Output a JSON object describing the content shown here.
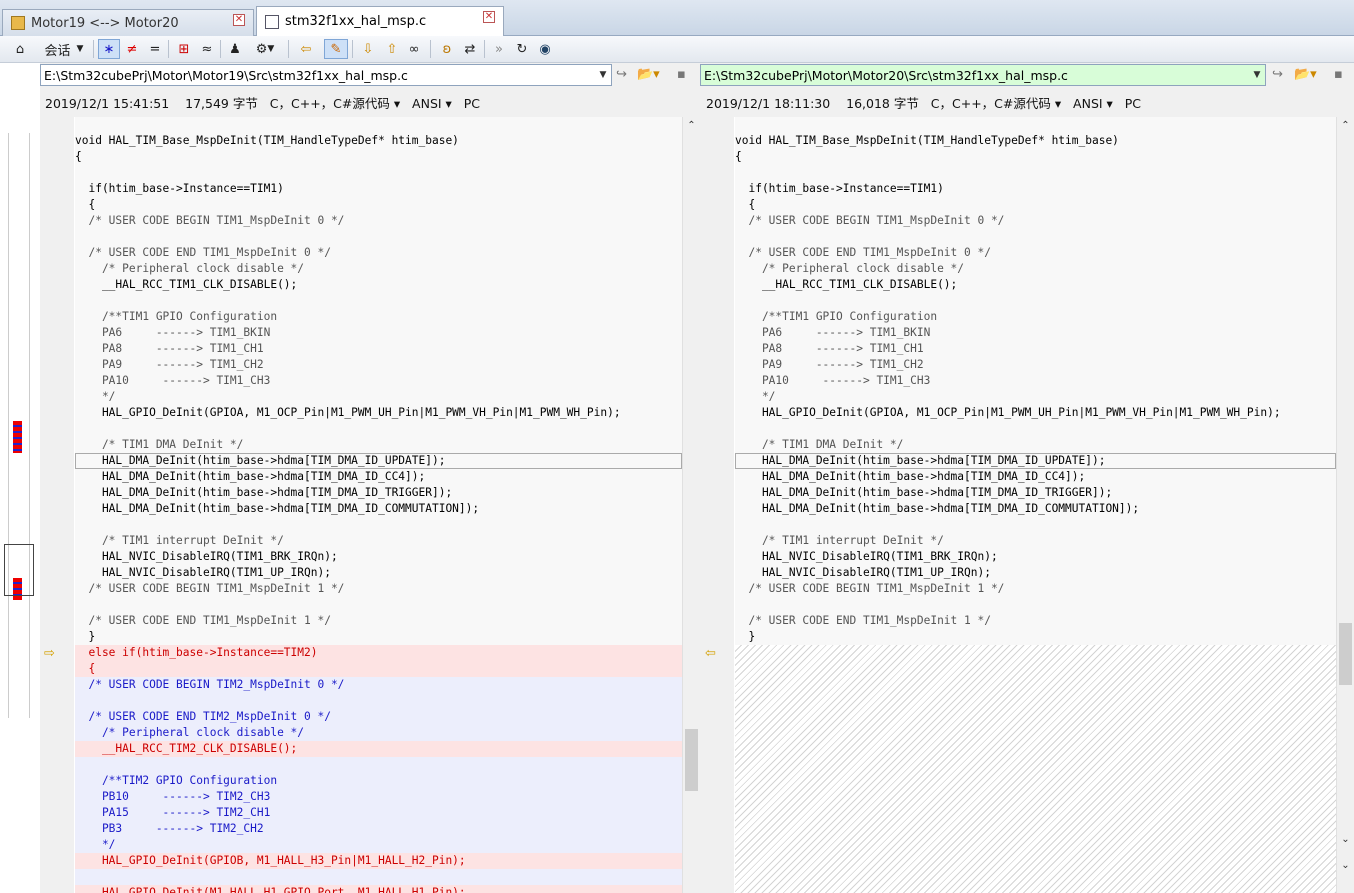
{
  "tabs": [
    {
      "label": "Motor19 <--> Motor20"
    },
    {
      "label": "stm32f1xx_hal_msp.c"
    }
  ],
  "toolbar": {
    "session_label": "会话",
    "icons": [
      "session-icon",
      "star-icon",
      "not-equal-icon",
      "equal-icon",
      "diff-icon",
      "approx-icon",
      "person-icon",
      "rules-icon",
      "back-arrow-icon",
      "edit-icon",
      "down-arrow-icon",
      "up-arrow-icon",
      "binoculars-icon",
      "ear-icon",
      "swap-icon",
      "expand-icon",
      "refresh-icon",
      "globe-icon"
    ]
  },
  "left": {
    "path": "E:\\Stm32cubePrj\\Motor\\Motor19\\Src\\stm32f1xx_hal_msp.c",
    "date": "2019/12/1 15:41:51",
    "size": "17,549 字节",
    "lang": "C，C++，C#源代码",
    "encoding": "ANSI",
    "lineend": "PC"
  },
  "right": {
    "path": "E:\\Stm32cubePrj\\Motor\\Motor20\\Src\\stm32f1xx_hal_msp.c",
    "date": "2019/12/1 18:11:30",
    "size": "16,018 字节",
    "lang": "C，C++，C#源代码",
    "encoding": "ANSI",
    "lineend": "PC"
  },
  "common_lines": [
    "void HAL_TIM_Base_MspDeInit(TIM_HandleTypeDef* htim_base)",
    "{",
    "",
    "  if(htim_base->Instance==TIM1)",
    "  {",
    "  /* USER CODE BEGIN TIM1_MspDeInit 0 */",
    "",
    "  /* USER CODE END TIM1_MspDeInit 0 */",
    "    /* Peripheral clock disable */",
    "    __HAL_RCC_TIM1_CLK_DISABLE();",
    "",
    "    /**TIM1 GPIO Configuration",
    "    PA6     ------> TIM1_BKIN",
    "    PA8     ------> TIM1_CH1",
    "    PA9     ------> TIM1_CH2",
    "    PA10     ------> TIM1_CH3",
    "    */",
    "    HAL_GPIO_DeInit(GPIOA, M1_OCP_Pin|M1_PWM_UH_Pin|M1_PWM_VH_Pin|M1_PWM_WH_Pin);",
    "",
    "    /* TIM1 DMA DeInit */",
    "    HAL_DMA_DeInit(htim_base->hdma[TIM_DMA_ID_UPDATE]);",
    "    HAL_DMA_DeInit(htim_base->hdma[TIM_DMA_ID_CC4]);",
    "    HAL_DMA_DeInit(htim_base->hdma[TIM_DMA_ID_TRIGGER]);",
    "    HAL_DMA_DeInit(htim_base->hdma[TIM_DMA_ID_COMMUTATION]);",
    "",
    "    /* TIM1 interrupt DeInit */",
    "    HAL_NVIC_DisableIRQ(TIM1_BRK_IRQn);",
    "    HAL_NVIC_DisableIRQ(TIM1_UP_IRQn);",
    "  /* USER CODE BEGIN TIM1_MspDeInit 1 */",
    "",
    "  /* USER CODE END TIM1_MspDeInit 1 */",
    "  }"
  ],
  "left_extra_lines": [
    {
      "text": "  else if(htim_base->Instance==TIM2)",
      "kind": "del"
    },
    {
      "text": "  {",
      "kind": "del"
    },
    {
      "text": "  /* USER CODE BEGIN TIM2_MspDeInit 0 */",
      "kind": "mod"
    },
    {
      "text": "",
      "kind": "mod"
    },
    {
      "text": "  /* USER CODE END TIM2_MspDeInit 0 */",
      "kind": "mod"
    },
    {
      "text": "    /* Peripheral clock disable */",
      "kind": "mod"
    },
    {
      "text": "    __HAL_RCC_TIM2_CLK_DISABLE();",
      "kind": "del"
    },
    {
      "text": "",
      "kind": "mod"
    },
    {
      "text": "    /**TIM2 GPIO Configuration",
      "kind": "mod"
    },
    {
      "text": "    PB10     ------> TIM2_CH3",
      "kind": "mod"
    },
    {
      "text": "    PA15     ------> TIM2_CH1",
      "kind": "mod"
    },
    {
      "text": "    PB3     ------> TIM2_CH2",
      "kind": "mod"
    },
    {
      "text": "    */",
      "kind": "mod"
    },
    {
      "text": "    HAL_GPIO_DeInit(GPIOB, M1_HALL_H3_Pin|M1_HALL_H2_Pin);",
      "kind": "del"
    },
    {
      "text": "",
      "kind": "mod"
    },
    {
      "text": "    HAL_GPIO_DeInit(M1_HALL_H1_GPIO_Port, M1_HALL_H1_Pin);",
      "kind": "del"
    }
  ]
}
